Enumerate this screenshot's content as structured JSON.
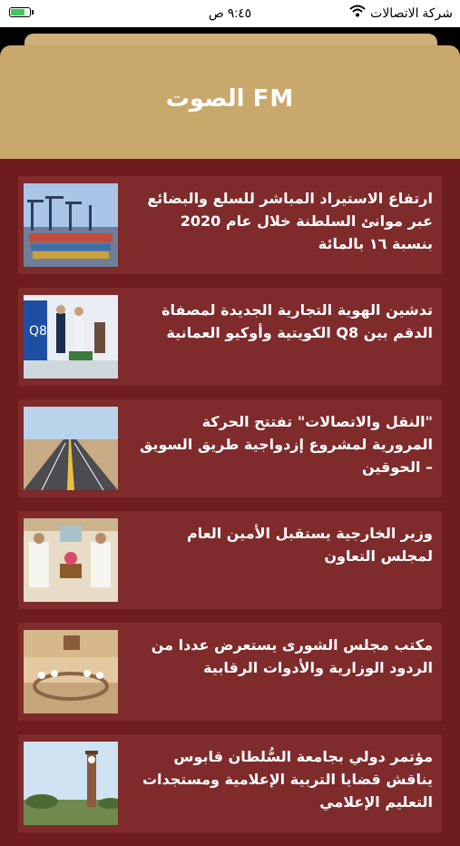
{
  "status_bar": {
    "carrier": "شركة الاتصالات",
    "time": "٩:٤٥ ص",
    "battery_level": 0.8
  },
  "header": {
    "logo_text": "الصوت FM"
  },
  "news": [
    {
      "headline": "ارتفاع الاستيراد المباشر للسلع والبضائع عبر موانئ السلطنة خلال عام 2020 بنسبة ١٦ بالمائة",
      "image": "port-cranes"
    },
    {
      "headline": "تدشين الهوية التجارية الجديدة لمصفاة الدقم بين Q8 الكويتية وأوكيو العمانية",
      "image": "q8-launch"
    },
    {
      "headline": "\"النقل والاتصالات\" تفتتح الحركة المرورية لمشروع إزدواجية طريق السويق – الحوقين",
      "image": "highway"
    },
    {
      "headline": "وزير الخارجية يستقبل الأمين العام لمجلس التعاون",
      "image": "minister-meeting"
    },
    {
      "headline": "مكتب مجلس الشورى يستعرض عددا من الردود الوزارية والأدوات الرقابية",
      "image": "council-hall"
    },
    {
      "headline": "مؤتمر دولي بجامعة السُّلطان قابوس يناقش قضايا التربية الإعلامية ومستجدات التعليم الإعلامي",
      "image": "clock-tower"
    }
  ],
  "colors": {
    "background": "#6e1c1d",
    "card": "#7f2a2b",
    "header_gold": "#c9a86c"
  }
}
